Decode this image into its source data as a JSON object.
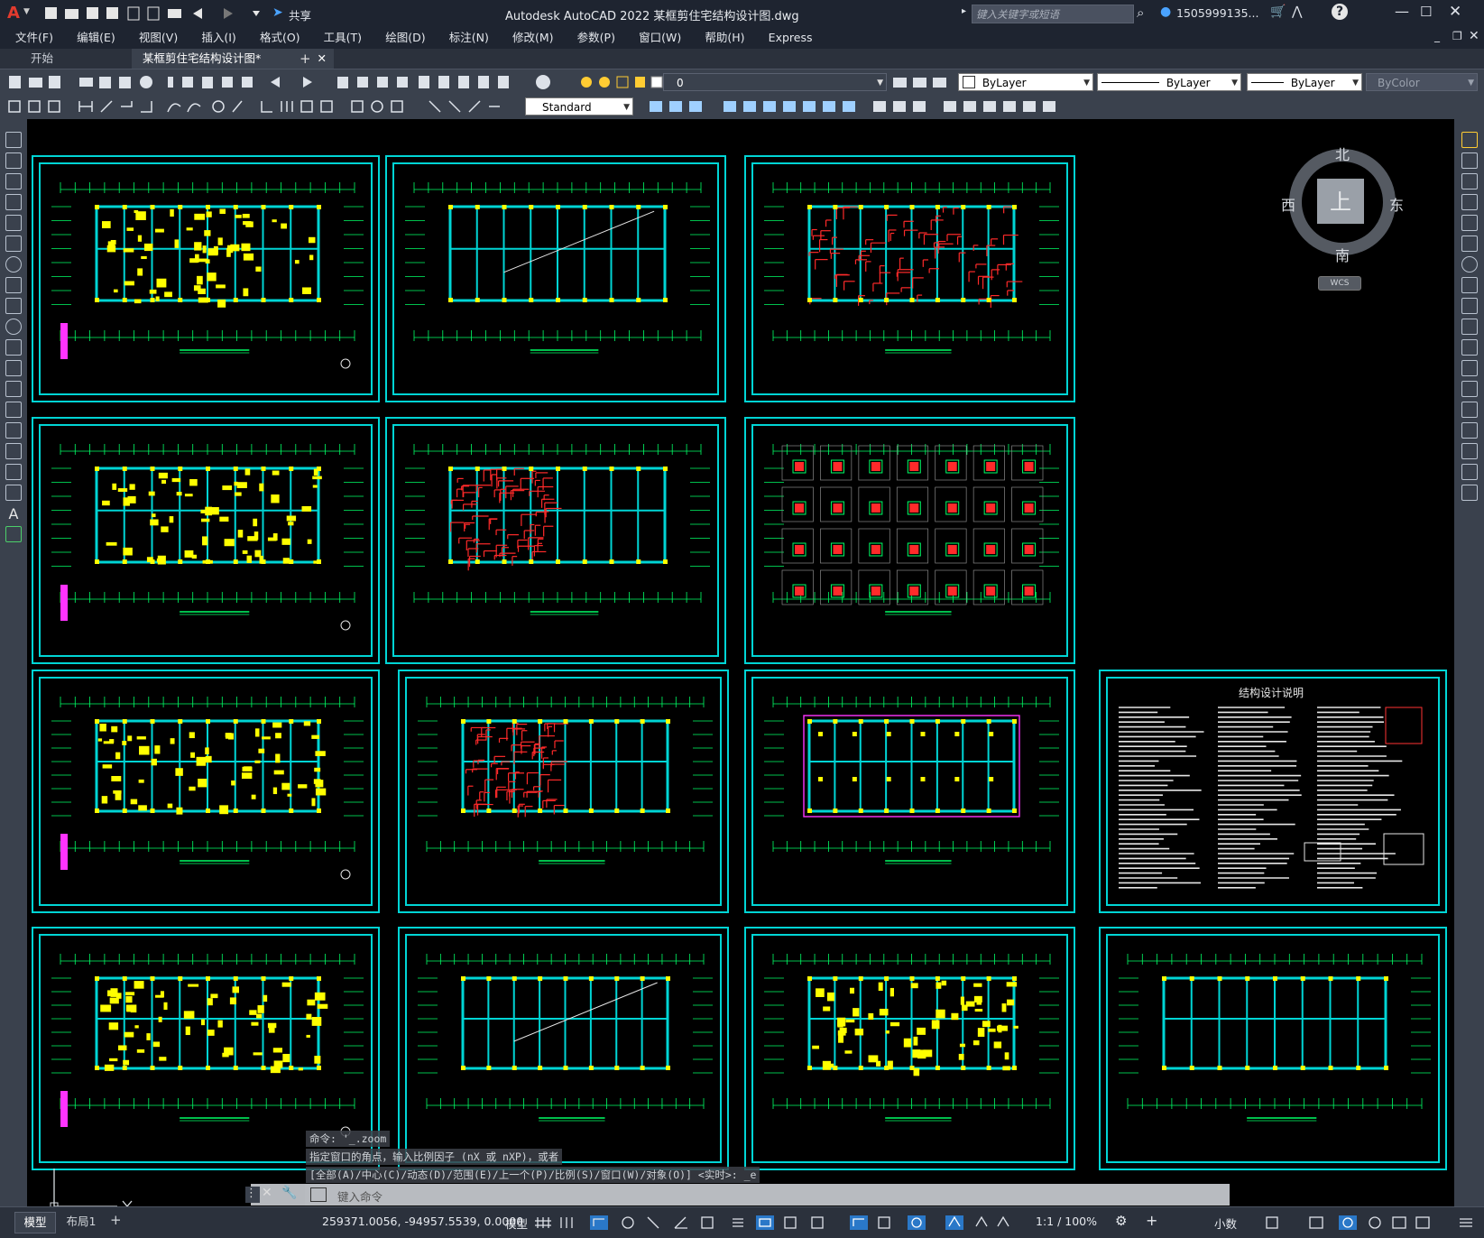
{
  "titlebar": {
    "app_logo": "A",
    "share_label": "共享",
    "title": "Autodesk AutoCAD 2022    某框剪住宅结构设计图.dwg",
    "search_placeholder": "键入关键字或短语",
    "user": "1505999135...",
    "help_icon": "?"
  },
  "menubar": {
    "items": [
      "文件(F)",
      "编辑(E)",
      "视图(V)",
      "插入(I)",
      "格式(O)",
      "工具(T)",
      "绘图(D)",
      "标注(N)",
      "修改(M)",
      "参数(P)",
      "窗口(W)",
      "帮助(H)",
      "Express"
    ]
  },
  "tabs": {
    "start": "开始",
    "active": "某框剪住宅结构设计图*",
    "add": "+"
  },
  "toolbar": {
    "layer_value": "0",
    "style_value": "Standard",
    "color": "ByLayer",
    "linetype": "ByLayer",
    "lineweight": "ByLayer",
    "plotstyle": "ByColor"
  },
  "viewcube": {
    "north": "北",
    "south": "南",
    "east": "东",
    "west": "西",
    "face": "上",
    "wcs": "WCS"
  },
  "command": {
    "history": [
      "命令: '_.zoom",
      "指定窗口的角点，输入比例因子 (nX 或 nXP)，或者",
      "[全部(A)/中心(C)/动态(D)/范围(E)/上一个(P)/比例(S)/窗口(W)/对象(O)] <实时>: _e"
    ],
    "placeholder": "键入命令"
  },
  "sheets": {
    "notes_title": "结构设计说明"
  },
  "statusbar": {
    "tab_model": "模型",
    "tab_layout": "布局1",
    "add": "+",
    "coords": "259371.0056, -94957.5539, 0.0000",
    "space": "模型",
    "scale": "1:1 / 100%",
    "units": "小数"
  },
  "colors": {
    "accent_cyan": "#00d5d5",
    "title_bg": "#1e2430",
    "toolbar_bg": "#3a414d"
  }
}
